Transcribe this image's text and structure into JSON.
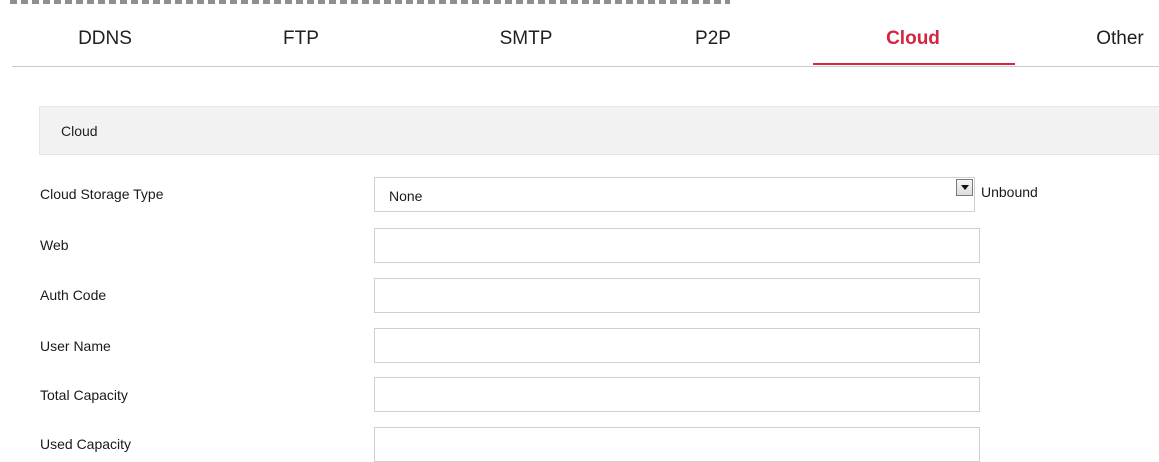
{
  "tabs": [
    {
      "id": "ddns",
      "label": "DDNS",
      "active": false
    },
    {
      "id": "ftp",
      "label": "FTP",
      "active": false
    },
    {
      "id": "smtp",
      "label": "SMTP",
      "active": false
    },
    {
      "id": "p2p",
      "label": "P2P",
      "active": false
    },
    {
      "id": "cloud",
      "label": "Cloud",
      "active": true
    },
    {
      "id": "other",
      "label": "Other",
      "active": false
    }
  ],
  "section": {
    "title": "Cloud"
  },
  "form": {
    "storage_type": {
      "label": "Cloud Storage Type",
      "value": "None",
      "status": "Unbound"
    },
    "web": {
      "label": "Web",
      "value": ""
    },
    "auth_code": {
      "label": "Auth Code",
      "value": ""
    },
    "user_name": {
      "label": "User Name",
      "value": ""
    },
    "total_capacity": {
      "label": "Total Capacity",
      "value": ""
    },
    "used_capacity": {
      "label": "Used Capacity",
      "value": ""
    }
  },
  "colors": {
    "accent": "#d2283e",
    "header_bg": "#f2f2f2",
    "border": "#cfcfcf"
  }
}
